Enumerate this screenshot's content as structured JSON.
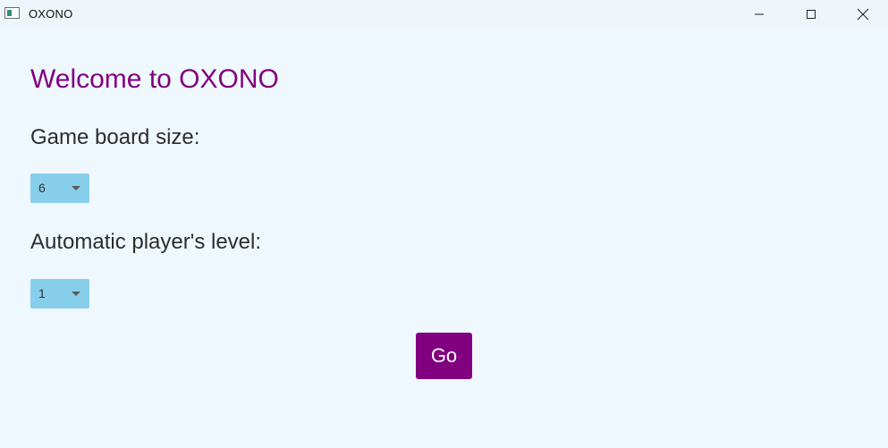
{
  "window": {
    "title": "OXONO",
    "icon": "app-window-icon",
    "controls": {
      "minimize_icon": "minimize-icon",
      "maximize_icon": "maximize-icon",
      "close_icon": "close-icon"
    }
  },
  "main": {
    "heading": "Welcome to OXONO",
    "board_size": {
      "label": "Game board size:",
      "selected": "6"
    },
    "player_level": {
      "label": "Automatic player's level:",
      "selected": "1"
    },
    "go_button": "Go"
  },
  "colors": {
    "background": "#f0f8ff",
    "accent": "#800080",
    "combo_background": "#87ceeb",
    "text": "#2d2d2d"
  }
}
